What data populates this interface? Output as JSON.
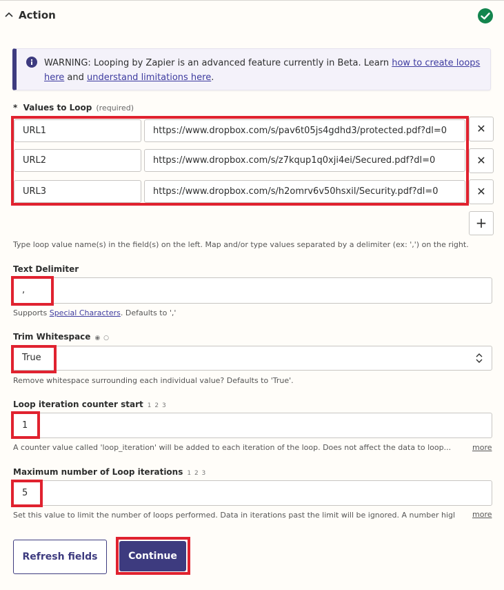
{
  "section": {
    "title": "Action"
  },
  "warning": {
    "text_before": "WARNING: Looping by Zapier is an advanced feature currently in Beta. Learn ",
    "link1": "how to create loops here",
    "middle": " and ",
    "link2": "understand limitations here",
    "end": "."
  },
  "values_to_loop": {
    "label": "Values to Loop",
    "required_mark": "*",
    "required_text": "(required)",
    "rows": [
      {
        "name": "URL1",
        "value": "https://www.dropbox.com/s/pav6t05js4gdhd3/protected.pdf?dl=0"
      },
      {
        "name": "URL2",
        "value": "https://www.dropbox.com/s/z7kqup1q0xji4ei/Secured.pdf?dl=0"
      },
      {
        "name": "URL3",
        "value": "https://www.dropbox.com/s/h2omrv6v50hsxil/Security.pdf?dl=0"
      }
    ],
    "remove_glyph": "✕",
    "add_glyph": "+",
    "help": "Type loop value name(s) in the field(s) on the left. Map and/or type values separated by a delimiter (ex: ',') on the right."
  },
  "text_delimiter": {
    "label": "Text Delimiter",
    "value": ",",
    "help_before": "Supports ",
    "help_link": "Special Characters",
    "help_after": ". Defaults to ','"
  },
  "trim_whitespace": {
    "label": "Trim Whitespace",
    "hint": "◉ ○",
    "value": "True",
    "help": "Remove whitespace surrounding each individual value? Defaults to 'True'."
  },
  "loop_counter": {
    "label": "Loop iteration counter start",
    "hint": "1 2 3",
    "value": "1",
    "help": "A counter value called 'loop_iteration' will be added to each iteration of the loop. Does not affect the data to loop...",
    "more": "more"
  },
  "max_iterations": {
    "label": "Maximum number of Loop iterations",
    "hint": "1 2 3",
    "value": "5",
    "help": "Set this value to limit the number of loops performed. Data in iterations past the limit will be ignored. A number higher...",
    "more": "more"
  },
  "buttons": {
    "refresh": "Refresh fields",
    "continue": "Continue"
  },
  "colors": {
    "accent": "#3d3b7f",
    "highlight": "#e0222f",
    "success": "#13854e"
  }
}
